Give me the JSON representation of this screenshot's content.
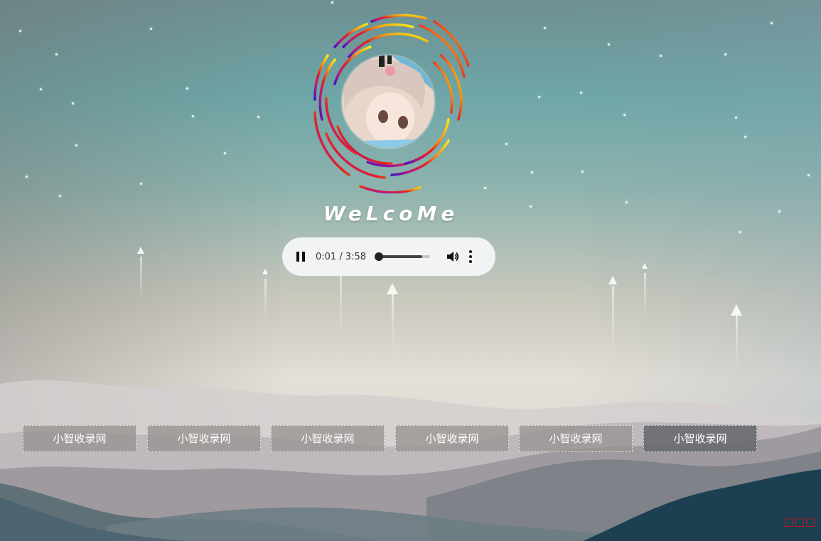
{
  "hero": {
    "title": "WeLcoMe"
  },
  "player": {
    "state": "playing",
    "current_time": "0:01",
    "duration": "3:58",
    "time_display": "0:01 / 3:58",
    "progress_fraction": 0.004,
    "volume_fraction": 0.85,
    "pause_icon": "pause-icon",
    "volume_icon": "volume-icon",
    "more_icon": "more-vertical-icon"
  },
  "nav": {
    "items": [
      {
        "label": "小智收录网"
      },
      {
        "label": "小智收录网"
      },
      {
        "label": "小智收录网"
      },
      {
        "label": "小智收录网"
      },
      {
        "label": "小智收录网"
      },
      {
        "label": "小智收录网"
      }
    ]
  },
  "corner": {
    "text": "□□□"
  },
  "colors": {
    "player_bg": "#f1f3f4",
    "nav_bg": "#969491",
    "nav_active_bg": "#696b70",
    "corner_text": "#dd1111"
  }
}
